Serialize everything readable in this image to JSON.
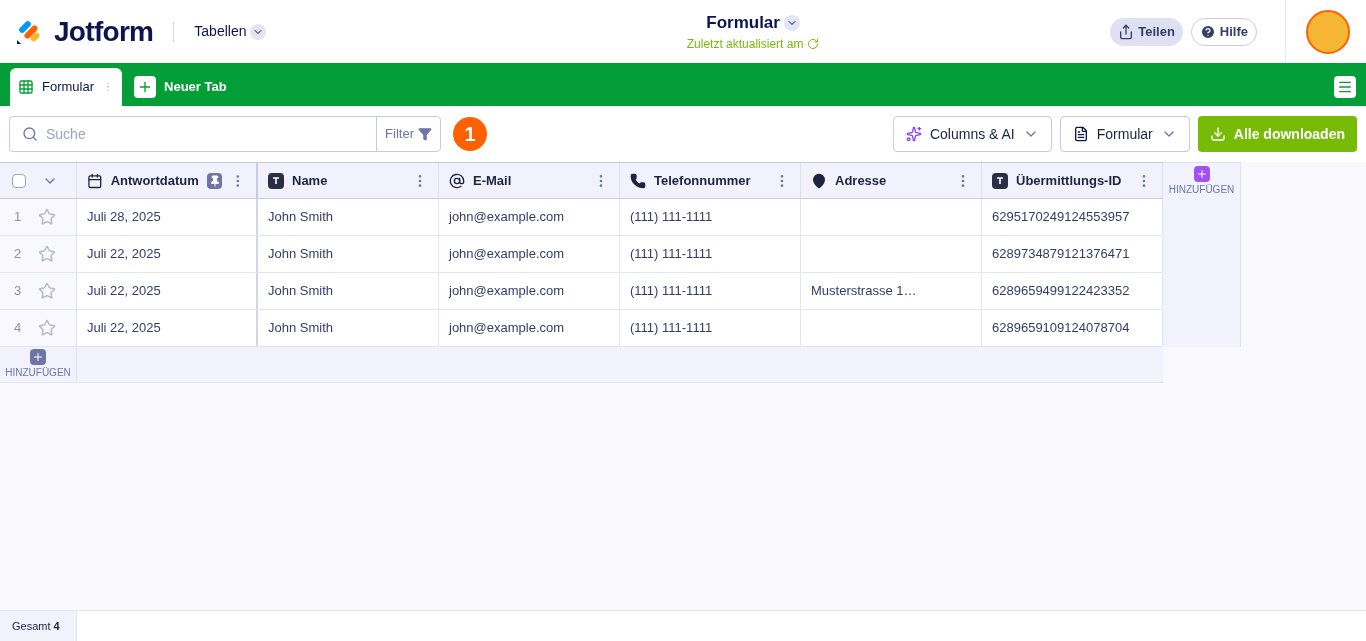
{
  "header": {
    "logo_text": "Jotform",
    "section": "Tabellen",
    "title": "Formular",
    "subtitle": "Zuletzt aktualisiert am",
    "share": "Teilen",
    "help": "Hilfe"
  },
  "tabs": [
    {
      "label": "Formular",
      "selected": true
    },
    {
      "label": "Neuer Tab",
      "selected": false
    }
  ],
  "toolbar": {
    "search_placeholder": "Suche",
    "filter": "Filter",
    "step_badge": "1",
    "columns_ai": "Columns & AI",
    "form_select": "Formular",
    "download": "Alle downloaden"
  },
  "table": {
    "columns": [
      {
        "label": "Antwortdatum",
        "kind": "date",
        "pinned": true
      },
      {
        "label": "Name",
        "kind": "text",
        "pinned": false
      },
      {
        "label": "E-Mail",
        "kind": "email",
        "pinned": false
      },
      {
        "label": "Telefonnummer",
        "kind": "phone",
        "pinned": false
      },
      {
        "label": "Adresse",
        "kind": "address",
        "pinned": false
      },
      {
        "label": "Übermittlungs-ID",
        "kind": "text",
        "pinned": false
      }
    ],
    "select_all_checked": false,
    "add_column": "HINZUFÜGEN",
    "rows": [
      {
        "number": "1",
        "starred": false,
        "cells": [
          "Juli 28, 2025",
          "John Smith",
          "john@example.com",
          "(111) 111-1111",
          "",
          "6295170249124553957"
        ]
      },
      {
        "number": "2",
        "starred": false,
        "cells": [
          "Juli 22, 2025",
          "John Smith",
          "john@example.com",
          "(111) 111-1111",
          "",
          "6289734879121376471"
        ]
      },
      {
        "number": "3",
        "starred": false,
        "cells": [
          "Juli 22, 2025",
          "John Smith",
          "john@example.com",
          "(111) 111-1111",
          "Musterstrasse 1…",
          "6289659499122423352"
        ]
      },
      {
        "number": "4",
        "starred": false,
        "cells": [
          "Juli 22, 2025",
          "John Smith",
          "john@example.com",
          "(111) 111-1111",
          "",
          "6289659109124078704"
        ]
      }
    ],
    "add_row": "HINZUFÜGEN"
  },
  "footer": {
    "total": "Gesamt **4**"
  }
}
